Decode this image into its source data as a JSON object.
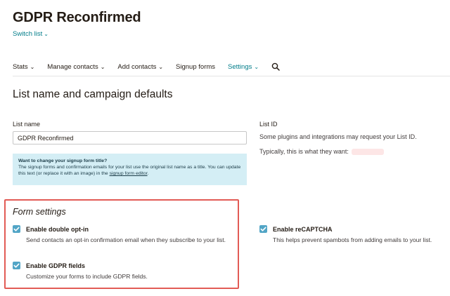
{
  "header": {
    "title": "GDPR Reconfirmed",
    "switch_list": "Switch list"
  },
  "nav": {
    "items": [
      {
        "label": "Stats",
        "dropdown": true
      },
      {
        "label": "Manage contacts",
        "dropdown": true
      },
      {
        "label": "Add contacts",
        "dropdown": true
      },
      {
        "label": "Signup forms",
        "dropdown": false
      },
      {
        "label": "Settings",
        "dropdown": true,
        "active": true
      }
    ],
    "search_icon": "search-icon"
  },
  "section": {
    "title": "List name and campaign defaults"
  },
  "list_name": {
    "label": "List name",
    "value": "GDPR Reconfirmed"
  },
  "info": {
    "title": "Want to change your signup form title?",
    "body": "The signup forms and confirmation emails for your list use the original list name as a title. You can update this text (or replace it with an image) in the ",
    "link": "signup form editor",
    "tail": "."
  },
  "list_id": {
    "label": "List ID",
    "line1": "Some plugins and integrations may request your List ID.",
    "line2": "Typically, this is what they want:"
  },
  "form_settings": {
    "title": "Form settings",
    "double_optin": {
      "label": "Enable double opt-in",
      "desc": "Send contacts an opt-in confirmation email when they subscribe to your list.",
      "checked": true
    },
    "gdpr": {
      "label": "Enable GDPR fields",
      "desc": "Customize your forms to include GDPR fields.",
      "checked": true
    },
    "recaptcha": {
      "label": "Enable reCAPTCHA",
      "desc": "This helps prevent spambots from adding emails to your list.",
      "checked": true
    }
  },
  "colors": {
    "accent": "#007c89",
    "checkbox": "#52a5c6",
    "info_bg": "#d4eef5",
    "highlight": "#e25b55"
  }
}
